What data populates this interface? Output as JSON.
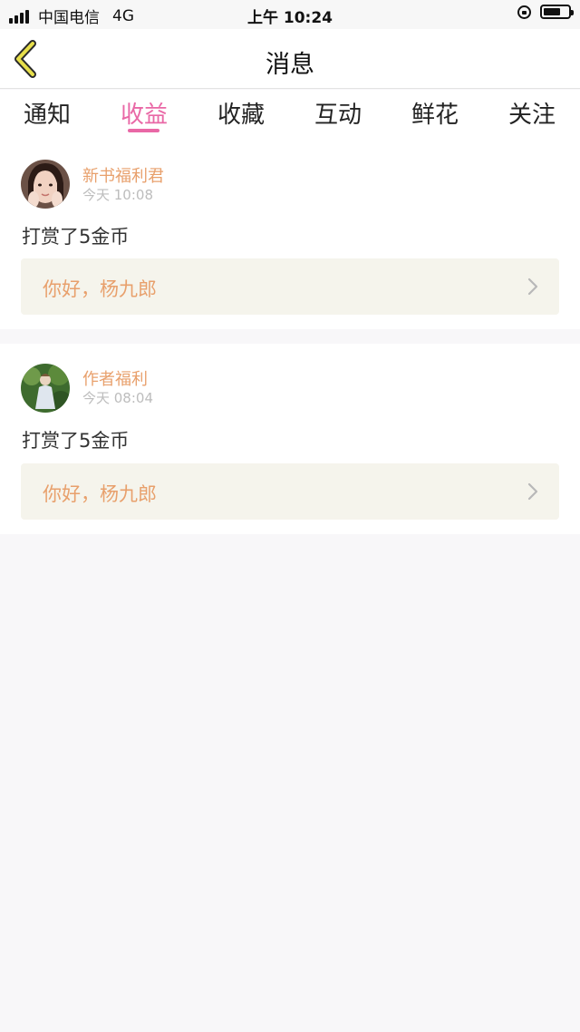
{
  "status_bar": {
    "carrier": "中国电信",
    "network": "4G",
    "time": "上午 10:24",
    "signal_bars": 4,
    "battery_level": 0.7
  },
  "nav": {
    "title": "消息",
    "back_icon": "chevron-left-icon"
  },
  "tabs": [
    {
      "label": "通知",
      "active": false
    },
    {
      "label": "收益",
      "active": true
    },
    {
      "label": "收藏",
      "active": false
    },
    {
      "label": "互动",
      "active": false
    },
    {
      "label": "鲜花",
      "active": false
    },
    {
      "label": "关注",
      "active": false
    }
  ],
  "colors": {
    "accent_pink": "#e968a6",
    "sender_orange": "#e8a06c",
    "quote_bg": "#f5f4ec",
    "back_icon_yellow": "#e7df4b"
  },
  "messages": [
    {
      "sender": "新书福利君",
      "time": "今天 10:08",
      "content": "打赏了5金币",
      "quote": "你好，杨九郎"
    },
    {
      "sender": "作者福利",
      "time": "今天 08:04",
      "content": "打赏了5金币",
      "quote": "你好，杨九郎"
    }
  ]
}
